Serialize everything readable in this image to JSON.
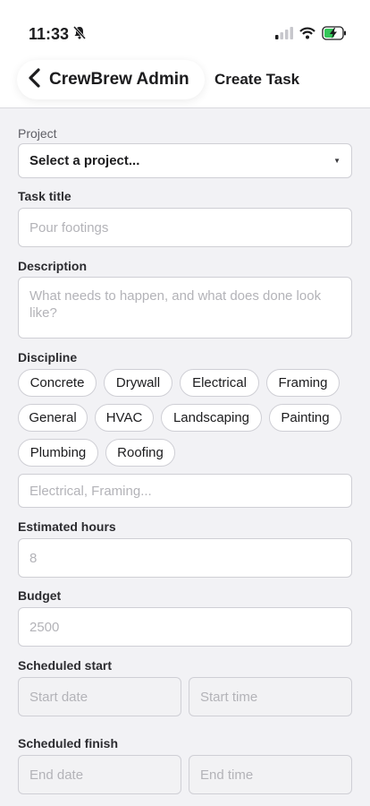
{
  "status_bar": {
    "time": "11:33"
  },
  "nav": {
    "back_label": "CrewBrew Admin",
    "title": "Create Task"
  },
  "project": {
    "label": "Project",
    "selected": "Select a project..."
  },
  "task_title": {
    "label": "Task title",
    "placeholder": "Pour footings"
  },
  "description": {
    "label": "Description",
    "placeholder": "What needs to happen, and what does done look like?"
  },
  "discipline": {
    "label": "Discipline",
    "chips": [
      "Concrete",
      "Drywall",
      "Electrical",
      "Framing",
      "General",
      "HVAC",
      "Landscaping",
      "Painting",
      "Plumbing",
      "Roofing"
    ],
    "custom_placeholder": "Electrical, Framing..."
  },
  "estimated_hours": {
    "label": "Estimated hours",
    "placeholder": "8"
  },
  "budget": {
    "label": "Budget",
    "placeholder": "2500"
  },
  "scheduled_start": {
    "label": "Scheduled start",
    "date_placeholder": "Start date",
    "time_placeholder": "Start time"
  },
  "scheduled_finish": {
    "label": "Scheduled finish",
    "date_placeholder": "End date",
    "time_placeholder": "End time"
  }
}
